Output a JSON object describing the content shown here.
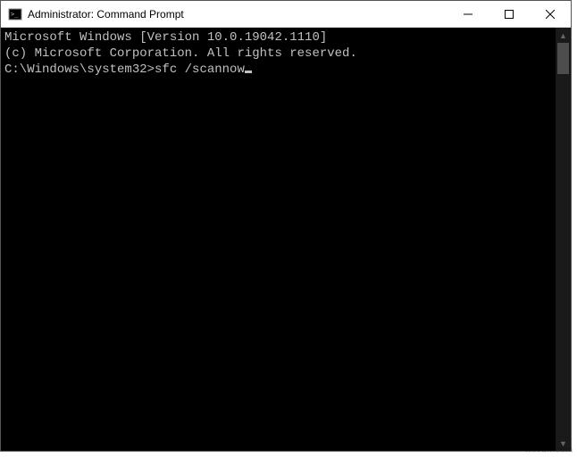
{
  "window": {
    "title": "Administrator: Command Prompt"
  },
  "terminal": {
    "line1": "Microsoft Windows [Version 10.0.19042.1110]",
    "line2": "(c) Microsoft Corporation. All rights reserved.",
    "blank": "",
    "prompt": "C:\\Windows\\system32>",
    "command": "sfc /scannow"
  },
  "watermark": "wsvdn.com"
}
